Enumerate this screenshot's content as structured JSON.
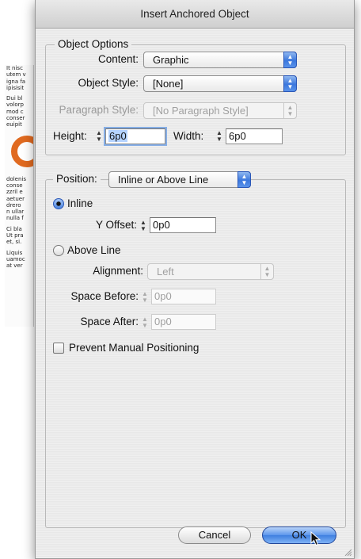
{
  "dialog": {
    "title": "Insert Anchored Object"
  },
  "background_doc": {
    "lines": [
      [
        "It nisc",
        "utem v",
        "igna fa",
        "ipisisit"
      ],
      [
        "Dui bl",
        "volorp",
        "mod c",
        "conser",
        "euipit"
      ],
      [
        "dolenis",
        "conse",
        "zzril e",
        "aetuer",
        "drero",
        "n ullar",
        "nulla f"
      ],
      [
        "Ci bla",
        "Ut pra",
        "et, si."
      ],
      [
        "Liquis",
        "uamoc",
        "at ver"
      ]
    ]
  },
  "object_options": {
    "legend": "Object Options",
    "content_label": "Content:",
    "content_value": "Graphic",
    "object_style_label": "Object Style:",
    "object_style_value": "[None]",
    "paragraph_style_label": "Paragraph Style:",
    "paragraph_style_value": "[No Paragraph Style]",
    "height_label": "Height:",
    "height_value": "6p0",
    "width_label": "Width:",
    "width_value": "6p0"
  },
  "position": {
    "label": "Position:",
    "value": "Inline or Above Line",
    "inline_label": "Inline",
    "y_offset_label": "Y Offset:",
    "y_offset_value": "0p0",
    "above_line_label": "Above Line",
    "alignment_label": "Alignment:",
    "alignment_value": "Left",
    "space_before_label": "Space Before:",
    "space_before_value": "0p0",
    "space_after_label": "Space After:",
    "space_after_value": "0p0",
    "prevent_label": "Prevent Manual Positioning"
  },
  "buttons": {
    "cancel": "Cancel",
    "ok": "OK"
  },
  "icons": {
    "popup_arrows": "up-down-arrows-icon",
    "stepper": "stepper-arrows-icon",
    "cursor": "mouse-pointer-icon",
    "grip": "resize-grip-icon"
  },
  "colors": {
    "accent": "#3b77dd",
    "window_bg": "#ececec"
  }
}
